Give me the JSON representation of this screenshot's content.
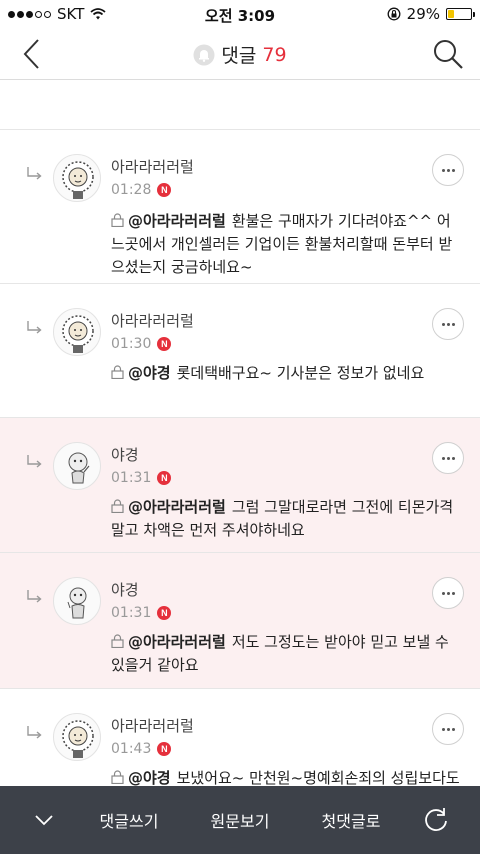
{
  "status": {
    "carrier": "SKT",
    "time": "오전 3:09",
    "battery_pct": "29%",
    "battery_level": 0.29,
    "battery_color": "#f2c400"
  },
  "nav": {
    "title": "댓글",
    "count": "79",
    "icons": [
      "back-chevron-icon",
      "bell-icon",
      "search-icon"
    ]
  },
  "comments": [
    {
      "author": "아라라러러럴",
      "time": "01:28",
      "new": "N",
      "mention": "@아라라러러럴",
      "text": "환불은 구매자가 기다려야죠^^ 어느곳에서 개인셀러든 기업이든 환불처리할때 돈부터 받으셨는지 궁금하네요~"
    },
    {
      "author": "아라라러러럴",
      "time": "01:30",
      "new": "N",
      "mention": "@야경",
      "text": "롯데택배구요~ 기사분은 정보가 없네요"
    },
    {
      "author": "야경",
      "time": "01:31",
      "new": "N",
      "mention": "@아라라러러럴",
      "text": "그럼 그말대로라면 그전에 티몬가격 말고 차액은 먼저 주셔야하네요"
    },
    {
      "author": "야경",
      "time": "01:31",
      "new": "N",
      "mention": "@아라라러러럴",
      "text": "저도 그정도는 받아야 믿고 보낼 수 있을거 같아요"
    },
    {
      "author": "아라라러러럴",
      "time": "01:43",
      "new": "N",
      "mention": "@야경",
      "text": "보냈어요~ 만천원~명예회손죄의 성립보다도 거지다, 가해자다, 사기꾼이다 몰아간점도 사람대 사람으로 올바른 행실은 아닌거같네요~"
    }
  ],
  "bottom": {
    "write": "댓글쓰기",
    "original": "원문보기",
    "first": "첫댓글로",
    "icons": [
      "chevron-down-icon",
      "refresh-icon"
    ],
    "bg_color": "#3d4149"
  },
  "colors": {
    "accent": "#e5303c",
    "highlight_bg": "#fcf0f1"
  }
}
